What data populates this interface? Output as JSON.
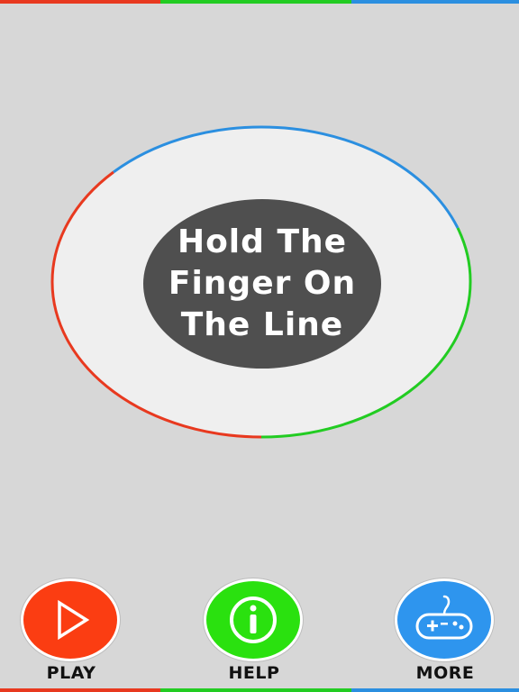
{
  "colors": {
    "background": "#d7d7d7",
    "ring_fill": "#efefef",
    "center_fill": "#4f4f4f",
    "red": "#e8391f",
    "green": "#22cc22",
    "blue": "#2b8fe0"
  },
  "center": {
    "lines": [
      "Hold The",
      "Finger On",
      "The Line"
    ]
  },
  "actions": [
    {
      "label": "PLAY",
      "icon": "play-triangle-icon",
      "color": "#fb3d12"
    },
    {
      "label": "HELP",
      "icon": "info-icon",
      "color": "#2ae10f"
    },
    {
      "label": "MORE",
      "icon": "gamepad-icon",
      "color": "#2e95ee"
    }
  ]
}
